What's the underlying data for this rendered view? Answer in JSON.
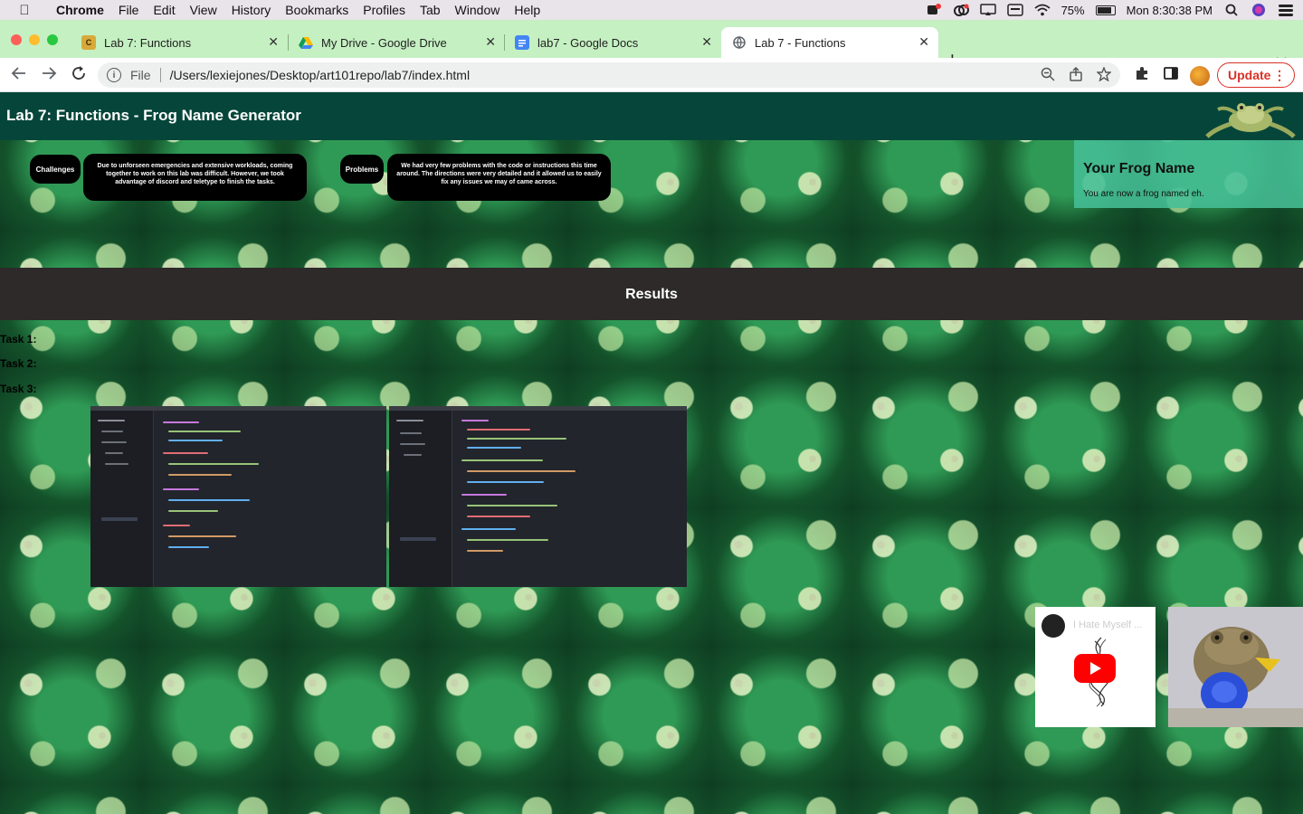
{
  "menubar": {
    "app_name": "Chrome",
    "menus": [
      "File",
      "Edit",
      "View",
      "History",
      "Bookmarks",
      "Profiles",
      "Tab",
      "Window",
      "Help"
    ],
    "battery_percent": "75%",
    "battery_level": 75,
    "clock": "Mon 8:30:38 PM"
  },
  "tabs": [
    {
      "title": "Lab 7: Functions",
      "favicon": "courseware-icon",
      "active": false
    },
    {
      "title": "My Drive - Google Drive",
      "favicon": "google-drive-icon",
      "active": false
    },
    {
      "title": "lab7 - Google Docs",
      "favicon": "google-docs-icon",
      "active": false
    },
    {
      "title": "Lab 7 - Functions",
      "favicon": "globe-icon",
      "active": true
    }
  ],
  "toolbar": {
    "scheme": "File",
    "url": "/Users/lexiejones/Desktop/art101repo/lab7/index.html",
    "update_label": "Update"
  },
  "page": {
    "title": "Lab 7: Functions - Frog Name Generator",
    "challenges_label": "Challenges",
    "challenges_text": "Due to unforseen emergencies and extensive workloads, coming together to work on this lab was difficult. However, we took advantage of discord and teletype to finish the tasks.",
    "problems_label": "Problems",
    "problems_text": "We had very few problems with the code or instructions this time around. The directions were very detailed and it allowed us to easily fix any issues we may of came across.",
    "frog_card_title": "Your Frog Name",
    "frog_card_text": "You are now a frog named eh.",
    "results_heading": "Results",
    "tasks": [
      "Task 1:",
      "Task 2:",
      "Task 3:"
    ],
    "video_title": "I Hate Myself ..."
  },
  "colors": {
    "tabstrip": "#c5f0c2",
    "page_header": "#06463a",
    "frog_card": "#46be96",
    "results_bar": "#2e2a2a",
    "update_accent": "#d93025"
  }
}
